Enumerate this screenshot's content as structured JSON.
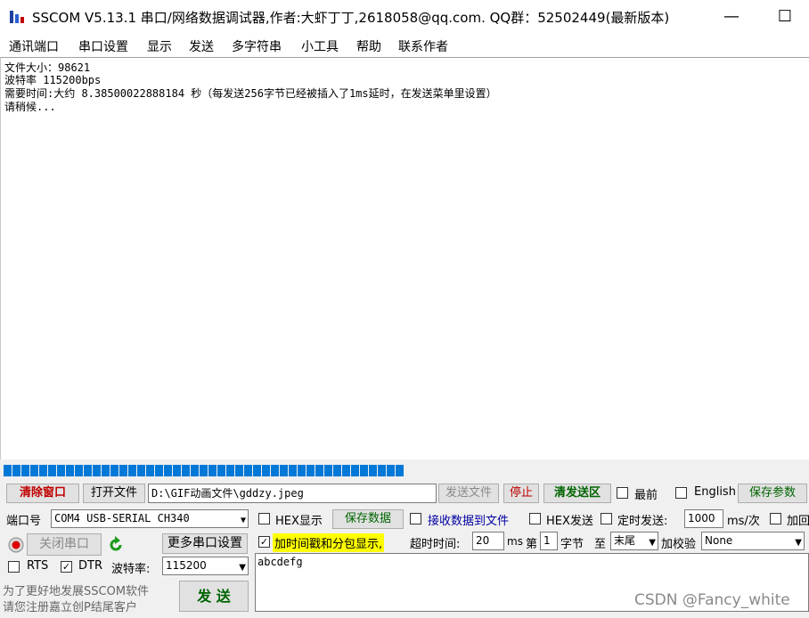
{
  "window": {
    "title": "SSCOM V5.13.1 串口/网络数据调试器,作者:大虾丁丁,2618058@qq.com. QQ群：52502449(最新版本)",
    "minimize": "—",
    "maximize": "☐"
  },
  "menu": [
    "通讯端口",
    "串口设置",
    "显示",
    "发送",
    "多字符串",
    "小工具",
    "帮助",
    "联系作者"
  ],
  "receive": {
    "lines": [
      "文件大小：98621",
      "波特率 115200bps",
      "需要时间:大约 8.38500022888184 秒（每发送256字节已经被插入了1ms延时，在发送菜单里设置）",
      "请稍候..."
    ]
  },
  "progress": {
    "value": 0.49,
    "segments": 45
  },
  "file_row": {
    "clear_window": "清除窗口",
    "open_file": "打开文件",
    "file_path": "D:\\GIF动画文件\\gddzy.jpeg",
    "send_file": "发送文件",
    "stop": "停止",
    "clear_send": "清发送区",
    "front_most": "最前",
    "english": "English",
    "save_params": "保存参数"
  },
  "port": {
    "port_label": "端口号",
    "port_value": "COM4 USB-SERIAL CH340",
    "close_port": "关闭串口",
    "more_settings": "更多串口设置",
    "rts": "RTS",
    "dtr": "DTR",
    "baud_label": "波特率:",
    "baud_value": "115200",
    "promo_line1": "为了更好地发展SSCOM软件",
    "promo_line2": "请您注册嘉立创P结尾客户",
    "send": "发 送"
  },
  "options": {
    "hex_display": "HEX显示",
    "save_data": "保存数据",
    "recv_to_file": "接收数据到文件",
    "hex_send": "HEX发送",
    "timed_send": "定时发送:",
    "interval": "1000",
    "interval_unit": "ms/次",
    "add_return": "加回",
    "timestamp": "加时间戳和分包显示,",
    "timeout_label": "超时时间:",
    "timeout_value": "20",
    "timeout_unit": "ms",
    "nth_label": "第",
    "nth_value": "1",
    "byte_label": "字节",
    "to_label": "至",
    "end_value": "末尾",
    "checksum_label": "加校验",
    "checksum_value": "None"
  },
  "send_text": "abcdefg",
  "watermark": "CSDN @Fancy_white",
  "colors": {
    "accent": "#0078d7",
    "highlight": "#ffff00",
    "red_text": "#c00000",
    "green_text": "#006400"
  }
}
